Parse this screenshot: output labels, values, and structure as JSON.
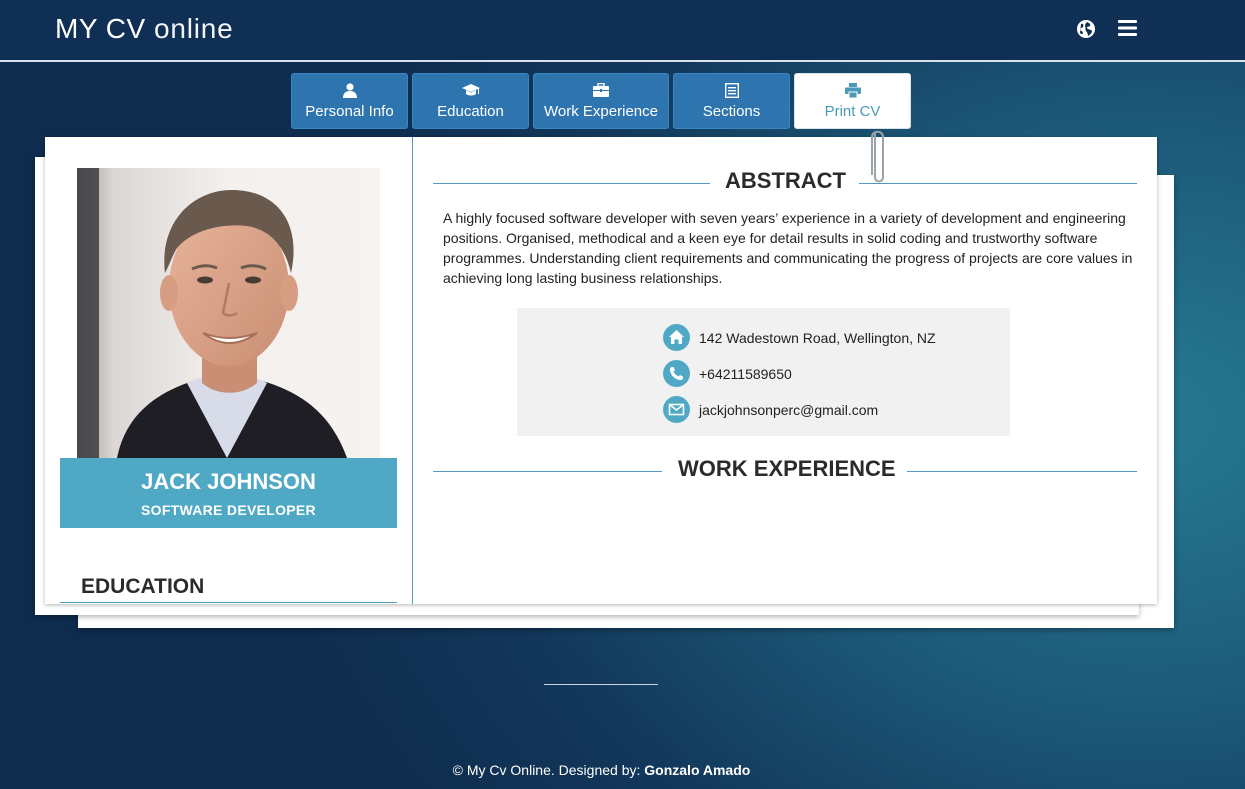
{
  "header": {
    "logo_prefix": "MY CV ",
    "logo_suffix": "online",
    "icons": [
      "globe-icon",
      "hamburger-menu-icon"
    ]
  },
  "tabs": [
    {
      "label": "Personal Info",
      "icon": "user-icon"
    },
    {
      "label": "Education",
      "icon": "graduation-cap-icon"
    },
    {
      "label": "Work Experience",
      "icon": "briefcase-icon"
    },
    {
      "label": "Sections",
      "icon": "list-icon"
    },
    {
      "label": "Print CV",
      "icon": "printer-icon",
      "active": true
    }
  ],
  "profile": {
    "name": "JACK JOHNSON",
    "role": "SOFTWARE DEVELOPER"
  },
  "sidebar": {
    "education_title": "EDUCATION"
  },
  "abstract": {
    "title": "ABSTRACT",
    "text": "A highly focused software developer with seven years’ experience in a variety of development and engineering positions. Organised, methodical and a keen eye for detail results in solid coding and trustworthy software programmes. Understanding client requirements and communicating the progress of projects are core values in achieving long lasting business relationships."
  },
  "contact": {
    "address": "142 Wadestown Road, Wellington, NZ",
    "phone": "+64211589650",
    "email": "jackjohnsonperc@gmail.com"
  },
  "work_experience": {
    "title": "WORK EXPERIENCE"
  },
  "footer": {
    "prefix": "© My Cv Online. Designed by: ",
    "author": "Gonzalo Amado"
  },
  "colors": {
    "header_bg": "#102f54",
    "tab_bg": "#2e75b0",
    "accent": "#4fa9c5"
  }
}
